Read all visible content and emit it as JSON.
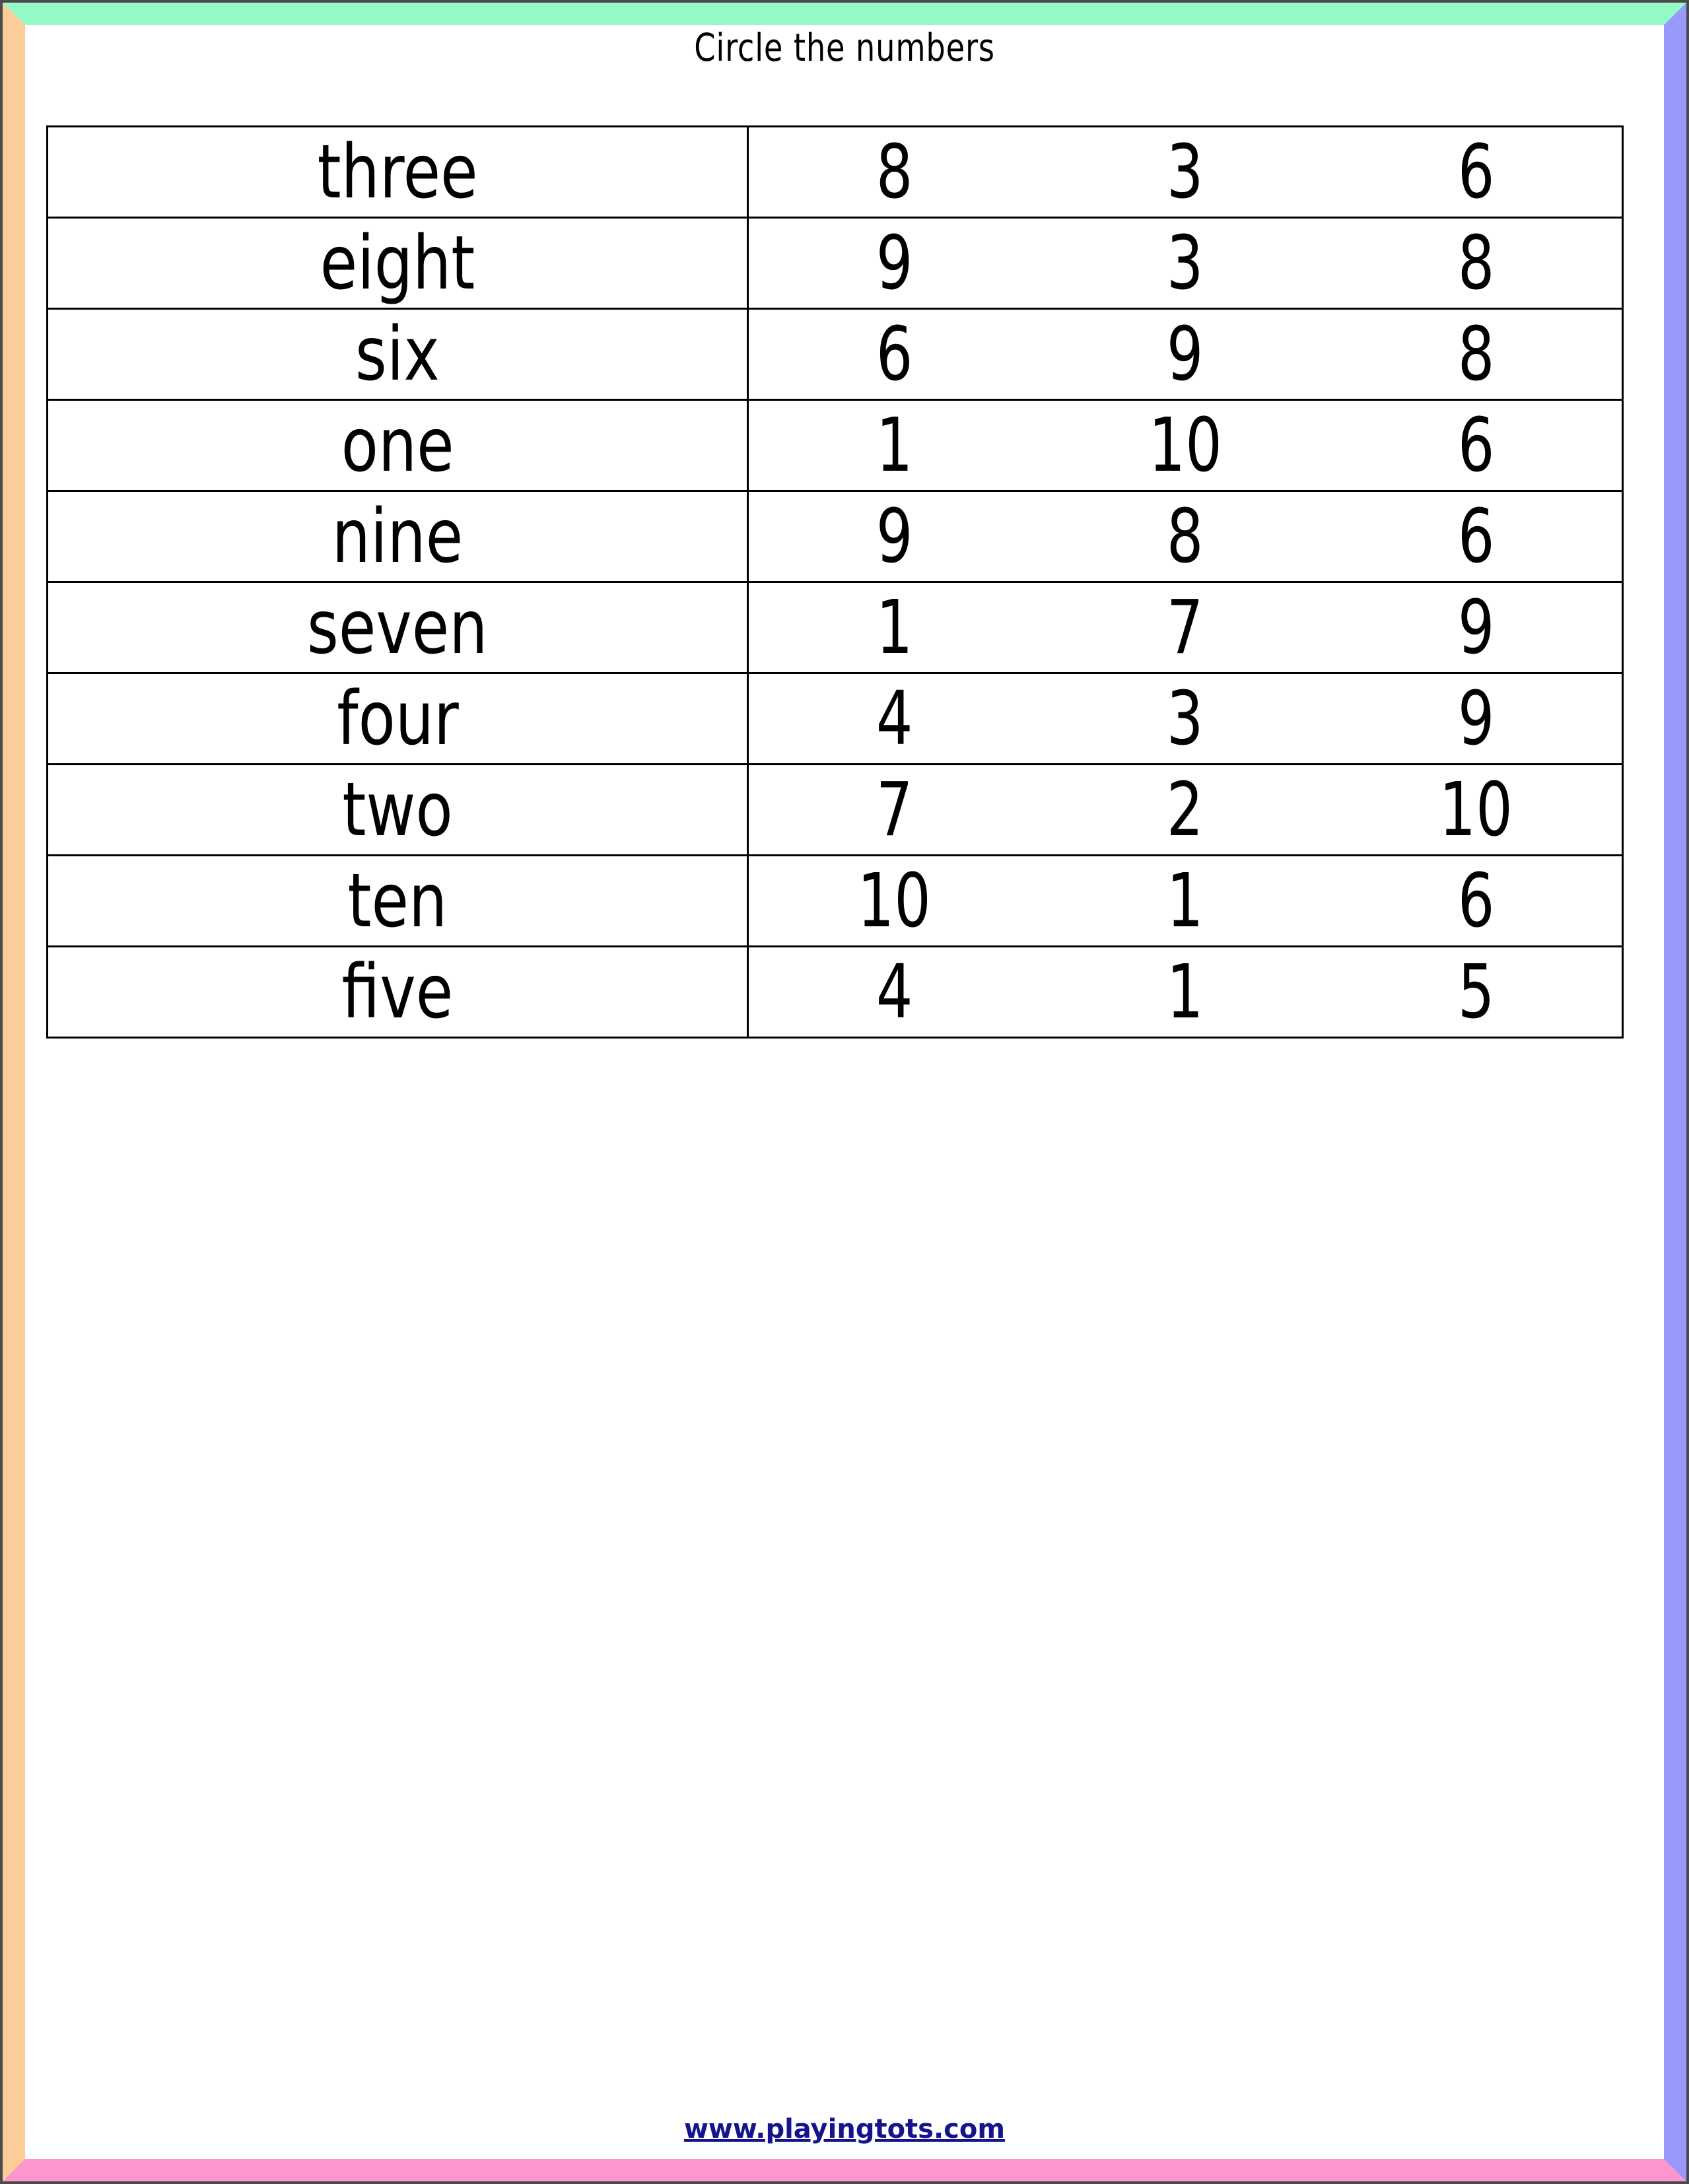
{
  "title": "Circle the numbers",
  "footer": {
    "link_text": "www.playingtots.com"
  },
  "colors": {
    "border_top": "#96fac8",
    "border_right": "#9999fc",
    "border_bottom": "#fc96cd",
    "border_left": "#fccd99",
    "outer_frame": "#4a4a4a",
    "text": "#000000",
    "link": "#14148c",
    "table_line": "#000000",
    "page_background": "#ffffff"
  },
  "table": {
    "rows": [
      {
        "word": "three",
        "numbers": [
          "8",
          "3",
          "6"
        ]
      },
      {
        "word": "eight",
        "numbers": [
          "9",
          "3",
          "8"
        ]
      },
      {
        "word": "six",
        "numbers": [
          "6",
          "9",
          "8"
        ]
      },
      {
        "word": "one",
        "numbers": [
          "1",
          "10",
          "6"
        ]
      },
      {
        "word": "nine",
        "numbers": [
          "9",
          "8",
          "6"
        ]
      },
      {
        "word": "seven",
        "numbers": [
          "1",
          "7",
          "9"
        ]
      },
      {
        "word": "four",
        "numbers": [
          "4",
          "3",
          "9"
        ]
      },
      {
        "word": "two",
        "numbers": [
          "7",
          "2",
          "10"
        ]
      },
      {
        "word": "ten",
        "numbers": [
          "10",
          "1",
          "6"
        ]
      },
      {
        "word": "five",
        "numbers": [
          "4",
          "1",
          "5"
        ]
      }
    ]
  }
}
